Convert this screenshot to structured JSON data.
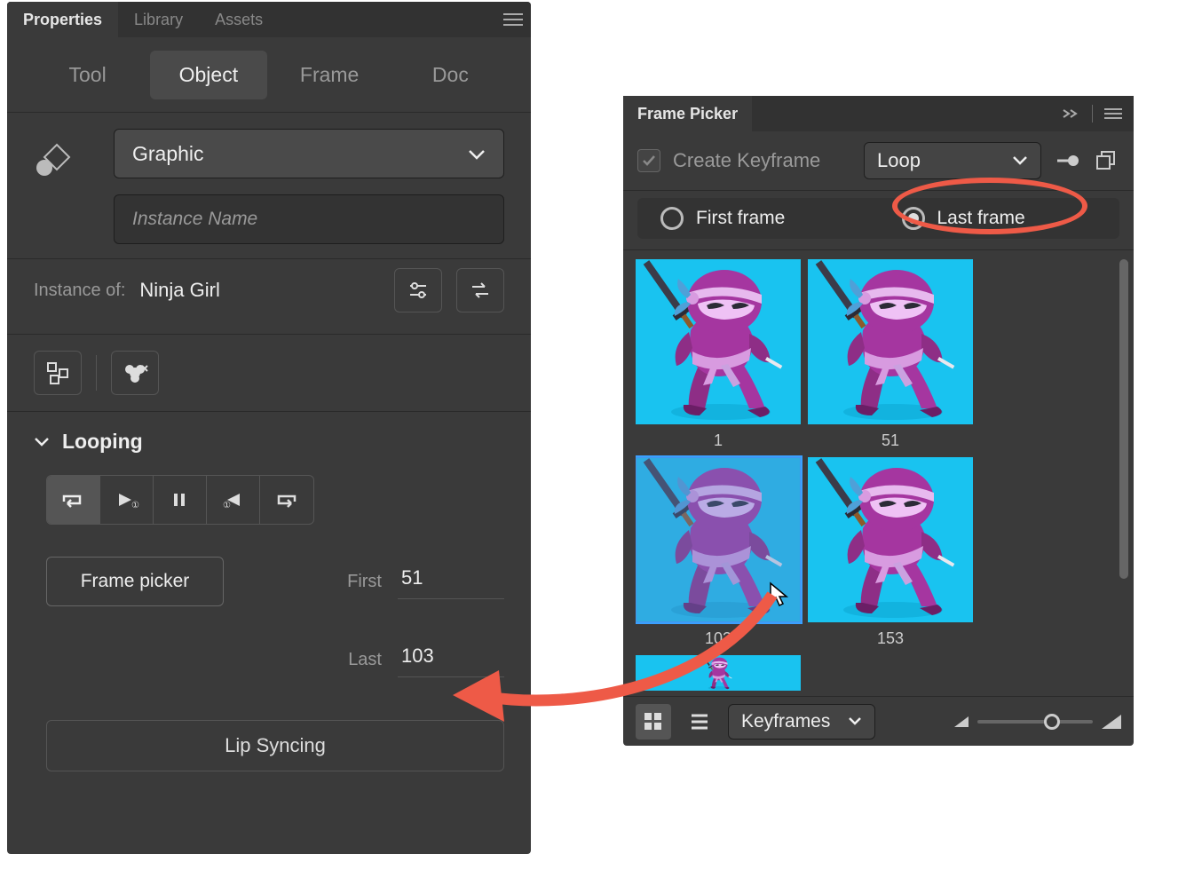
{
  "properties": {
    "tabs": [
      "Properties",
      "Library",
      "Assets"
    ],
    "active_tab": 0,
    "modes": [
      "Tool",
      "Object",
      "Frame",
      "Doc"
    ],
    "active_mode": 1,
    "symbol_type": "Graphic",
    "instance_name_placeholder": "Instance Name",
    "instance_of_label": "Instance of:",
    "instance_of_name": "Ninja Girl",
    "looping_label": "Looping",
    "frame_picker_btn": "Frame picker",
    "first_label": "First",
    "first_value": "51",
    "last_label": "Last",
    "last_value": "103",
    "lipsync_btn": "Lip Syncing"
  },
  "picker": {
    "title": "Frame Picker",
    "create_keyframe_label": "Create Keyframe",
    "loop_dropdown": "Loop",
    "radio_first": "First frame",
    "radio_last": "Last frame",
    "radio_selected": "last",
    "keyframes_dropdown": "Keyframes",
    "frames": [
      {
        "num": "1",
        "selected": false
      },
      {
        "num": "51",
        "selected": false
      },
      {
        "num": "103",
        "selected": true
      },
      {
        "num": "153",
        "selected": false
      },
      {
        "num": "",
        "selected": false,
        "partial": true
      }
    ]
  }
}
